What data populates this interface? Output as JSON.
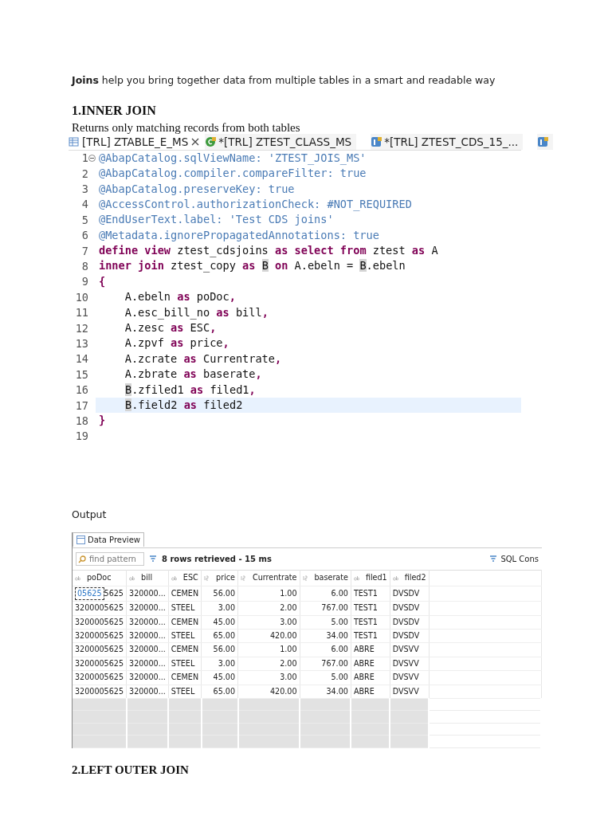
{
  "intro": "**Joins** help you bring together data from multiple tables in a smart and readable way",
  "section": {
    "heading": "1.INNER JOIN",
    "description": "Returns only matching records from both tables"
  },
  "editor_tabs": [
    {
      "label": "[TRL] ZTABLE_E_MS",
      "kind": "table",
      "selected": true
    },
    {
      "label": "*[TRL] ZTEST_CLASS_MS",
      "kind": "class",
      "selected": false
    },
    {
      "label": "*[TRL] ZTEST_CDS_15_...",
      "kind": "cds",
      "selected": false
    },
    {
      "kind": "cds",
      "selected": false
    }
  ],
  "code_lines": [
    {
      "number": "1",
      "folding": true,
      "current": false,
      "segments": [
        {
          "text": "@AbapCatalog.sqlViewName: 'ZTEST_JOIS_MS'",
          "kind": "annotation"
        }
      ]
    },
    {
      "number": "2",
      "current": false,
      "segments": [
        {
          "text": "@AbapCatalog.compiler.compareFilter: true",
          "kind": "annotation"
        }
      ]
    },
    {
      "number": "3",
      "current": false,
      "segments": [
        {
          "text": "@AbapCatalog.preserveKey: true",
          "kind": "annotation"
        }
      ]
    },
    {
      "number": "4",
      "current": false,
      "segments": [
        {
          "text": "@AccessControl.authorizationCheck: #NOT_REQUIRED",
          "kind": "annotation"
        }
      ]
    },
    {
      "number": "5",
      "current": false,
      "segments": [
        {
          "text": "@EndUserText.label: 'Test CDS joins'",
          "kind": "annotation"
        }
      ]
    },
    {
      "number": "6",
      "current": false,
      "segments": [
        {
          "text": "@Metadata.ignorePropagatedAnnotations: true",
          "kind": "annotation"
        }
      ]
    },
    {
      "number": "7",
      "current": false,
      "segments": [
        {
          "text": "define view",
          "kind": "keyword"
        },
        {
          "text": " ztest_cdsjoins ",
          "kind": "plain"
        },
        {
          "text": "as select from",
          "kind": "keyword"
        },
        {
          "text": " ztest ",
          "kind": "plain"
        },
        {
          "text": "as",
          "kind": "keyword"
        },
        {
          "text": " A",
          "kind": "plain"
        }
      ]
    },
    {
      "number": "8",
      "current": false,
      "segments": [
        {
          "text": "inner join",
          "kind": "keyword"
        },
        {
          "text": " ztest_copy ",
          "kind": "plain"
        },
        {
          "text": "as ",
          "kind": "keyword"
        },
        {
          "text": "B",
          "kind": "marked"
        },
        {
          "text": " on",
          "kind": "keyword"
        },
        {
          "text": " A.ebeln = ",
          "kind": "plain"
        },
        {
          "text": "B",
          "kind": "marked"
        },
        {
          "text": ".ebeln",
          "kind": "plain"
        }
      ]
    },
    {
      "number": "9",
      "current": false,
      "segments": [
        {
          "text": "{",
          "kind": "keyword"
        }
      ]
    },
    {
      "number": "10",
      "current": false,
      "segments": [
        {
          "text": "    A.ebeln ",
          "kind": "plain"
        },
        {
          "text": "as",
          "kind": "keyword"
        },
        {
          "text": " poDoc",
          "kind": "plain"
        },
        {
          "text": ",",
          "kind": "keyword"
        }
      ]
    },
    {
      "number": "11",
      "current": false,
      "segments": [
        {
          "text": "    A.esc_bill_no ",
          "kind": "plain"
        },
        {
          "text": "as",
          "kind": "keyword"
        },
        {
          "text": " bill",
          "kind": "plain"
        },
        {
          "text": ",",
          "kind": "keyword"
        }
      ]
    },
    {
      "number": "12",
      "current": false,
      "segments": [
        {
          "text": "    A.zesc ",
          "kind": "plain"
        },
        {
          "text": "as",
          "kind": "keyword"
        },
        {
          "text": " ESC",
          "kind": "plain"
        },
        {
          "text": ",",
          "kind": "keyword"
        }
      ]
    },
    {
      "number": "13",
      "current": false,
      "segments": [
        {
          "text": "    A.zpvf ",
          "kind": "plain"
        },
        {
          "text": "as",
          "kind": "keyword"
        },
        {
          "text": " price",
          "kind": "plain"
        },
        {
          "text": ",",
          "kind": "keyword"
        }
      ]
    },
    {
      "number": "14",
      "current": false,
      "segments": [
        {
          "text": "    A.zcrate ",
          "kind": "plain"
        },
        {
          "text": "as",
          "kind": "keyword"
        },
        {
          "text": " Currentrate",
          "kind": "plain"
        },
        {
          "text": ",",
          "kind": "keyword"
        }
      ]
    },
    {
      "number": "15",
      "current": false,
      "segments": [
        {
          "text": "    A.zbrate ",
          "kind": "plain"
        },
        {
          "text": "as",
          "kind": "keyword"
        },
        {
          "text": " baserate",
          "kind": "plain"
        },
        {
          "text": ",",
          "kind": "keyword"
        }
      ]
    },
    {
      "number": "16",
      "current": false,
      "indent": true,
      "segments": [
        {
          "text": "B",
          "kind": "marked"
        },
        {
          "text": ".zfiled1 ",
          "kind": "plain"
        },
        {
          "text": "as",
          "kind": "keyword"
        },
        {
          "text": " filed1",
          "kind": "plain"
        },
        {
          "text": ",",
          "kind": "keyword"
        }
      ]
    },
    {
      "number": "17",
      "current": true,
      "indent": true,
      "segments": [
        {
          "text": "B",
          "kind": "marked"
        },
        {
          "text": ".field2 ",
          "kind": "plain"
        },
        {
          "text": "as",
          "kind": "keyword"
        },
        {
          "text": " filed2",
          "kind": "plain"
        }
      ]
    },
    {
      "number": "18",
      "current": false,
      "segments": [
        {
          "text": "}",
          "kind": "keyword"
        }
      ]
    },
    {
      "number": "19",
      "current": false
    }
  ],
  "output_label": "Output",
  "data_preview": {
    "tab": "Data Preview",
    "filter_placeholder": "find pattern",
    "status": "8 rows retrieved - 15 ms",
    "sql_console": "SQL Cons",
    "columns": [
      {
        "name": "poDoc",
        "kind": "text"
      },
      {
        "name": "bill",
        "kind": "text"
      },
      {
        "name": "ESC",
        "kind": "text"
      },
      {
        "name": "price",
        "kind": "number"
      },
      {
        "name": "Currentrate",
        "kind": "number"
      },
      {
        "name": "baserate",
        "kind": "number"
      },
      {
        "name": "filed1",
        "kind": "text"
      },
      {
        "name": "filed2",
        "kind": "text"
      }
    ],
    "rows": [
      [
        {
          "text": "5625",
          "editor": "05625"
        },
        "320000...",
        "CEMEN",
        "56.00",
        "1.00",
        "6.00",
        "TEST1",
        "DVSDV"
      ],
      [
        "3200005625",
        "320000...",
        "STEEL",
        "3.00",
        "2.00",
        "767.00",
        "TEST1",
        "DVSDV"
      ],
      [
        "3200005625",
        "320000...",
        "CEMEN",
        "45.00",
        "3.00",
        "5.00",
        "TEST1",
        "DVSDV"
      ],
      [
        "3200005625",
        "320000...",
        "STEEL",
        "65.00",
        "420.00",
        "34.00",
        "TEST1",
        "DVSDV"
      ],
      [
        "3200005625",
        "320000...",
        "CEMEN",
        "56.00",
        "1.00",
        "6.00",
        "ABRE",
        "DVSVV"
      ],
      [
        "3200005625",
        "320000...",
        "STEEL",
        "3.00",
        "2.00",
        "767.00",
        "ABRE",
        "DVSVV"
      ],
      [
        "3200005625",
        "320000...",
        "CEMEN",
        "45.00",
        "3.00",
        "5.00",
        "ABRE",
        "DVSVV"
      ],
      [
        "3200005625",
        "320000...",
        "STEEL",
        "65.00",
        "420.00",
        "34.00",
        "ABRE",
        "DVSVV"
      ]
    ]
  },
  "next_heading": "2.LEFT OUTER JOIN"
}
